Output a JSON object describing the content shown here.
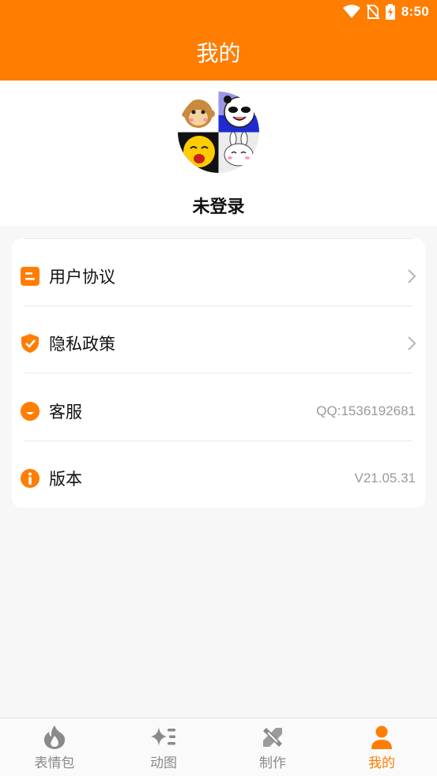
{
  "status_bar": {
    "time": "8:50",
    "icons": [
      "wifi-icon",
      "no-sim-icon",
      "battery-charging-icon"
    ]
  },
  "header": {
    "title": "我的"
  },
  "profile": {
    "avatar_icon": "emoji-collage-avatar",
    "username": "未登录"
  },
  "menu": {
    "items": [
      {
        "icon": "document-icon",
        "label": "用户协议",
        "value": "",
        "chevron": true
      },
      {
        "icon": "shield-check-icon",
        "label": "隐私政策",
        "value": "",
        "chevron": true
      },
      {
        "icon": "smile-icon",
        "label": "客服",
        "value": "QQ:1536192681",
        "chevron": false
      },
      {
        "icon": "info-icon",
        "label": "版本",
        "value": "V21.05.31",
        "chevron": false
      }
    ]
  },
  "tabs": [
    {
      "icon": "flame-icon",
      "label": "表情包",
      "active": false
    },
    {
      "icon": "sparkle-list-icon",
      "label": "动图",
      "active": false
    },
    {
      "icon": "pencil-ruler-icon",
      "label": "制作",
      "active": false
    },
    {
      "icon": "user-icon",
      "label": "我的",
      "active": true
    }
  ],
  "colors": {
    "accent": "#ff7d00",
    "background": "#f7f7f7",
    "secondary_text": "#9a9a9a",
    "inactive_tab": "#8a8a8a"
  }
}
